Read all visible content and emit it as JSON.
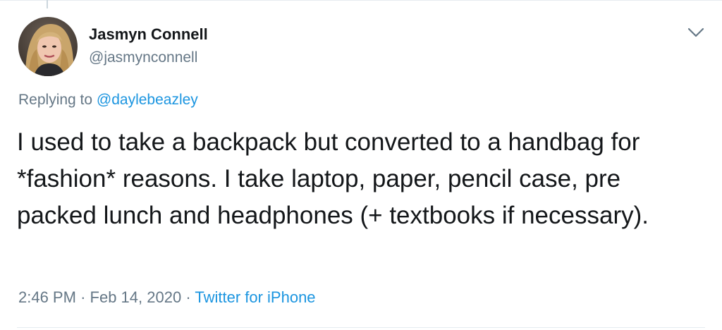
{
  "tweet": {
    "author": {
      "display_name": "Jasmyn Connell",
      "handle": "@jasmynconnell"
    },
    "replying_to_label": "Replying to",
    "replying_to_handle": "@daylebeazley",
    "text": "I used to take a backpack but converted to a handbag for *fashion* reasons. I take laptop, paper, pencil case, pre packed lunch and headphones (+ textbooks if necessary).",
    "time": "2:46 PM",
    "date": "Feb 14, 2020",
    "separator": "·",
    "source": "Twitter for iPhone"
  },
  "icons": {
    "menu": "chevron-down-icon"
  },
  "colors": {
    "text_primary": "#14171a",
    "text_secondary": "#657786",
    "link": "#1b95e0",
    "divider": "#e6ecf0"
  }
}
